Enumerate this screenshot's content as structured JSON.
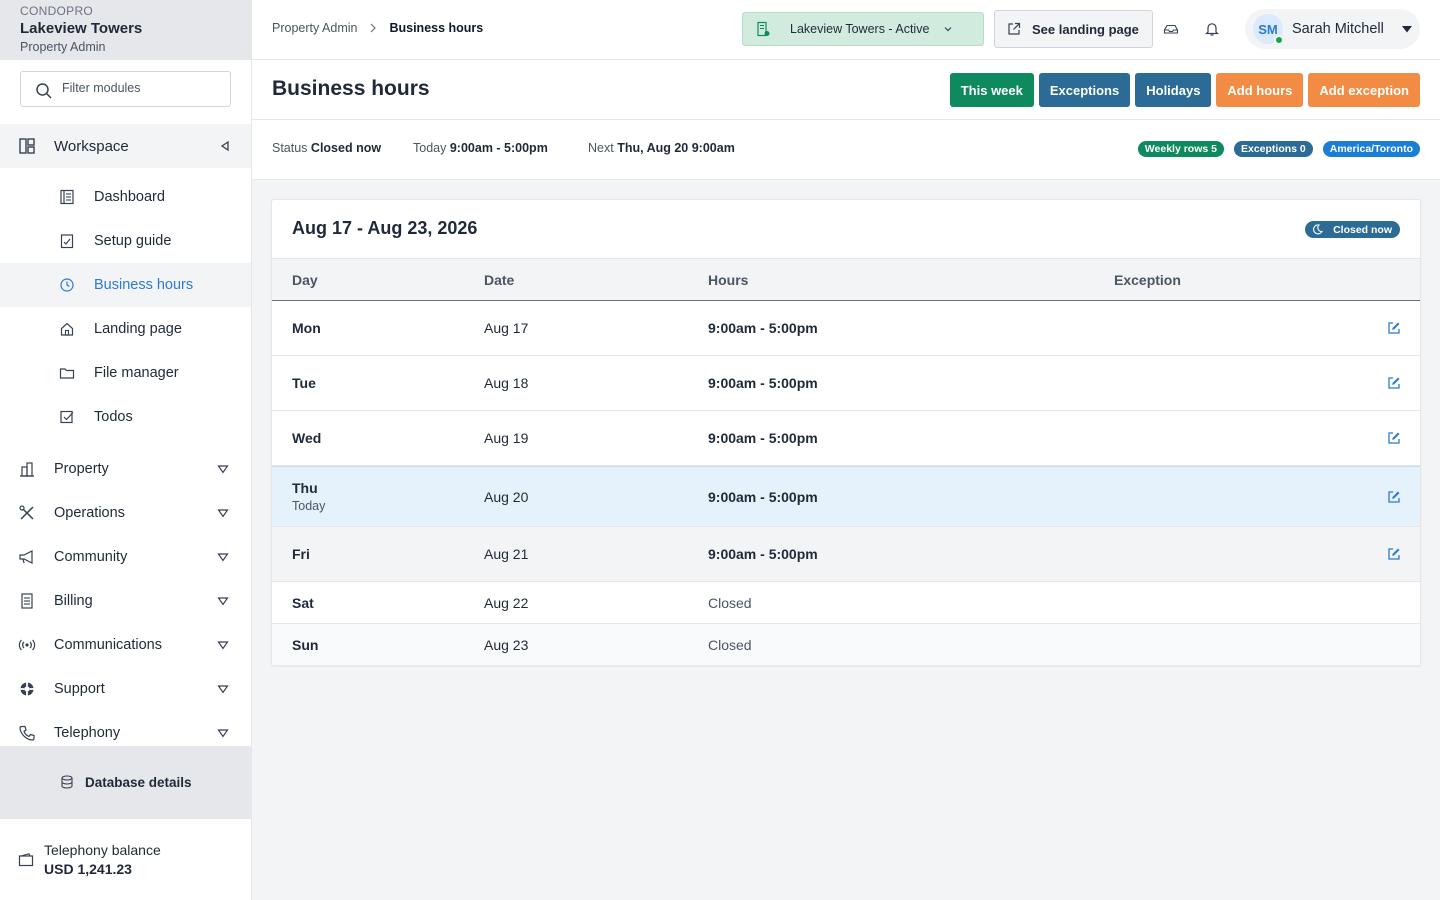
{
  "sidebar": {
    "org": "CONDOPRO",
    "property": "Lakeview Towers",
    "role": "Property Admin",
    "filter_placeholder": "Filter modules",
    "workspace": {
      "label": "Workspace",
      "items": [
        {
          "label": "Dashboard",
          "icon": "dashboard-icon"
        },
        {
          "label": "Setup guide",
          "icon": "checklist-icon"
        },
        {
          "label": "Business hours",
          "icon": "clock-icon",
          "active": true
        },
        {
          "label": "Landing page",
          "icon": "home-icon"
        },
        {
          "label": "File manager",
          "icon": "folder-icon"
        },
        {
          "label": "Todos",
          "icon": "checkbox-icon"
        }
      ]
    },
    "sections": [
      {
        "label": "Property",
        "icon": "building-icon"
      },
      {
        "label": "Operations",
        "icon": "tools-icon"
      },
      {
        "label": "Community",
        "icon": "megaphone-icon"
      },
      {
        "label": "Billing",
        "icon": "receipt-icon"
      },
      {
        "label": "Communications",
        "icon": "broadcast-icon"
      },
      {
        "label": "Support",
        "icon": "lifebuoy-icon"
      },
      {
        "label": "Telephony",
        "icon": "phone-icon"
      }
    ],
    "database_details": "Database details",
    "balance_label": "Telephony balance",
    "balance_value": "USD 1,241.23"
  },
  "topbar": {
    "breadcrumb": [
      "Property Admin",
      "Business hours"
    ],
    "property_select": "Lakeview Towers - Active",
    "landing_button": "See landing page",
    "user_initials": "SM",
    "user_name": "Sarah Mitchell"
  },
  "page": {
    "title": "Business hours",
    "actions": [
      {
        "label": "This week",
        "color": "#0f8a5f"
      },
      {
        "label": "Exceptions",
        "color": "#2b6b95"
      },
      {
        "label": "Holidays",
        "color": "#2b6b95"
      },
      {
        "label": "Add hours",
        "color": "#f28c45"
      },
      {
        "label": "Add exception",
        "color": "#f28c45"
      }
    ]
  },
  "status": {
    "status_label": "Status",
    "status_value": "Closed now",
    "today_label": "Today",
    "today_value": "9:00am - 5:00pm",
    "next_label": "Next",
    "next_value": "Thu, Aug 20 9:00am",
    "badges": [
      "Weekly rows 5",
      "Exceptions 0",
      "America/Toronto"
    ]
  },
  "week": {
    "title": "Aug 17 - Aug 23, 2026",
    "state": "Closed now",
    "columns": [
      "Day",
      "Date",
      "Hours",
      "Exception"
    ],
    "rows": [
      {
        "day": "Mon",
        "date": "Aug 17",
        "hours": "9:00am - 5:00pm",
        "exception": ""
      },
      {
        "day": "Tue",
        "date": "Aug 18",
        "hours": "9:00am - 5:00pm",
        "exception": ""
      },
      {
        "day": "Wed",
        "date": "Aug 19",
        "hours": "9:00am - 5:00pm",
        "exception": ""
      },
      {
        "day": "Thu",
        "date": "Aug 20",
        "hours": "9:00am - 5:00pm",
        "exception": "",
        "note": "Today"
      },
      {
        "day": "Fri",
        "date": "Aug 21",
        "hours": "9:00am - 5:00pm",
        "exception": ""
      },
      {
        "day": "Sat",
        "date": "Aug 22",
        "hours": "Closed",
        "exception": ""
      },
      {
        "day": "Sun",
        "date": "Aug 23",
        "hours": "Closed",
        "exception": ""
      }
    ]
  },
  "colors": {
    "accent_blue": "#2b7bd0",
    "green": "#0f8a5f",
    "teal": "#2b6b95",
    "orange": "#f28c45",
    "today_row": "#e5f1fb"
  }
}
